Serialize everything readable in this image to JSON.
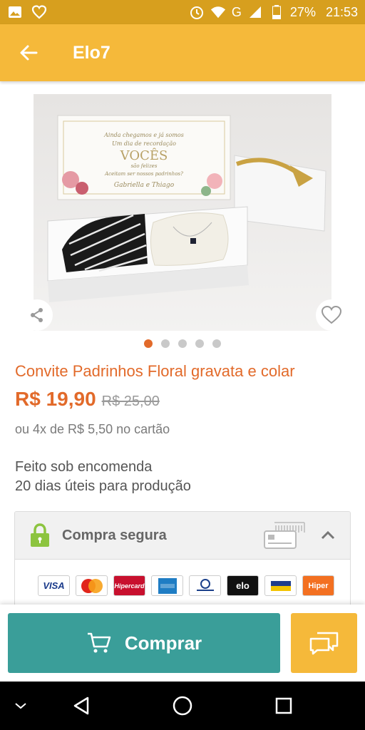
{
  "status_bar": {
    "battery": "27%",
    "time": "21:53",
    "network": "G",
    "icons": [
      "image-icon",
      "heart-outline-icon",
      "alarm-icon",
      "wifi-icon",
      "signal-icon",
      "battery-icon"
    ]
  },
  "app_bar": {
    "title": "Elo7",
    "back_icon": "arrow-left-icon",
    "color": "#f5b93a"
  },
  "product": {
    "image_caption_lines": [
      "Ainda chegamos e já somos",
      "Um dia de recordação",
      "VOCÊS",
      "são felizes",
      "Aceitam ser nossos padrinhos?",
      "Gabriella e Thiago"
    ],
    "carousel": {
      "count": 5,
      "active": 1
    },
    "title": "Convite Padrinhos Floral gravata e colar",
    "price": "R$ 19,90",
    "old_price": "R$ 25,00",
    "installments": "ou 4x de R$ 5,50 no cartão",
    "production_line1": "Feito sob encomenda",
    "production_line2": "20 dias úteis para produção",
    "accent_color": "#e26a2a"
  },
  "secure": {
    "label": "Compra segura",
    "cards": [
      "VISA",
      "Master",
      "Hipercard",
      "Amex",
      "Diners",
      "elo",
      "Banes",
      "Hiper"
    ]
  },
  "actions": {
    "buy_label": "Comprar",
    "buy_color": "#3a9e99",
    "chat_color": "#f5b93a"
  },
  "nav": [
    "collapse-icon",
    "back-triangle-icon",
    "home-circle-icon",
    "recents-square-icon"
  ]
}
